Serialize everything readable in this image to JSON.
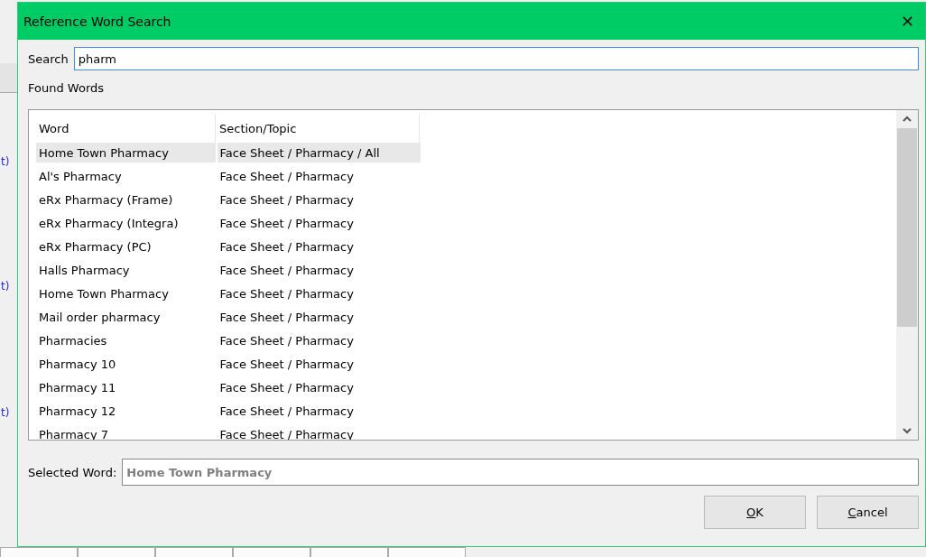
{
  "background": {
    "fragments": [
      "t)",
      "t)",
      "t)"
    ]
  },
  "window": {
    "title": "Reference Word Search",
    "close": "✕"
  },
  "search": {
    "label": "Search",
    "value": "pharm"
  },
  "found_words": {
    "label": "Found Words"
  },
  "table": {
    "columns": [
      "Word",
      "Section/Topic"
    ],
    "rows": [
      {
        "word": "Home Town Pharmacy",
        "section": "Face Sheet / Pharmacy / All",
        "selected": true
      },
      {
        "word": "Al's Pharmacy",
        "section": "Face Sheet / Pharmacy",
        "selected": false
      },
      {
        "word": "eRx Pharmacy (Frame)",
        "section": "Face Sheet / Pharmacy",
        "selected": false
      },
      {
        "word": "eRx Pharmacy (Integra)",
        "section": "Face Sheet / Pharmacy",
        "selected": false
      },
      {
        "word": "eRx Pharmacy (PC)",
        "section": "Face Sheet / Pharmacy",
        "selected": false
      },
      {
        "word": "Halls Pharmacy",
        "section": "Face Sheet / Pharmacy",
        "selected": false
      },
      {
        "word": "Home Town Pharmacy",
        "section": "Face Sheet / Pharmacy",
        "selected": false
      },
      {
        "word": "Mail order pharmacy",
        "section": "Face Sheet / Pharmacy",
        "selected": false
      },
      {
        "word": "Pharmacies",
        "section": "Face Sheet / Pharmacy",
        "selected": false
      },
      {
        "word": "Pharmacy 10",
        "section": "Face Sheet / Pharmacy",
        "selected": false
      },
      {
        "word": "Pharmacy 11",
        "section": "Face Sheet / Pharmacy",
        "selected": false
      },
      {
        "word": "Pharmacy 12",
        "section": "Face Sheet / Pharmacy",
        "selected": false
      },
      {
        "word": "Pharmacy 7",
        "section": "Face Sheet / Pharmacy",
        "selected": false
      }
    ]
  },
  "selected_word": {
    "label": "Selected Word:",
    "value": "Home Town Pharmacy"
  },
  "buttons": [
    {
      "label": "OK"
    },
    {
      "label": "Cancel"
    }
  ]
}
